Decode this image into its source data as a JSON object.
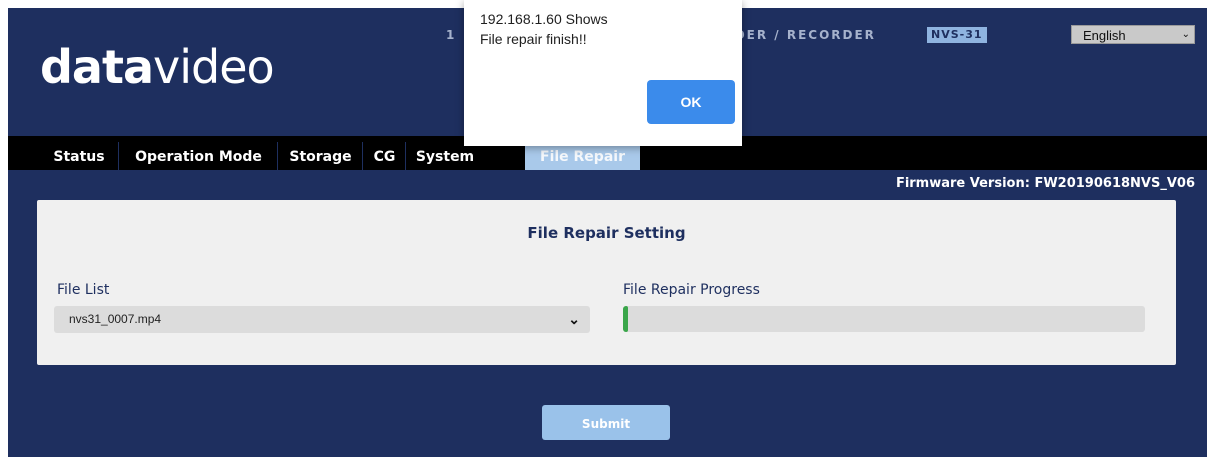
{
  "header": {
    "logo_bold": "data",
    "logo_light": "video",
    "model_title_prefix": "1",
    "model_title": "DDER / RECORDER",
    "model_badge": "NVS-31",
    "language": {
      "selected": "English"
    }
  },
  "nav": {
    "tabs": [
      {
        "label": "Status",
        "active": false
      },
      {
        "label": "Operation Mode",
        "active": false
      },
      {
        "label": "Storage",
        "active": false
      },
      {
        "label": "CG",
        "active": false
      },
      {
        "label": "System",
        "active": false
      },
      {
        "label": "File Repair",
        "active": true
      }
    ]
  },
  "firmware": {
    "text": "Firmware Version: FW20190618NVS_V06"
  },
  "panel": {
    "title": "File Repair Setting",
    "file_list_label": "File List",
    "file_selected": "nvs31_0007.mp4",
    "progress_label": "File Repair Progress",
    "progress_fraction": 0.01
  },
  "submit_label": "Submit",
  "dialog": {
    "title": "192.168.1.60 Shows",
    "message": "File repair finish!!",
    "ok_label": "OK"
  },
  "colors": {
    "background": "#1e2f5f",
    "active_tab": "#a9c9ea",
    "progress": "#3aa64a",
    "ok_button": "#3b8beb",
    "submit_button": "#9ac2ea"
  },
  "icons": [
    "chevron-down-icon"
  ]
}
